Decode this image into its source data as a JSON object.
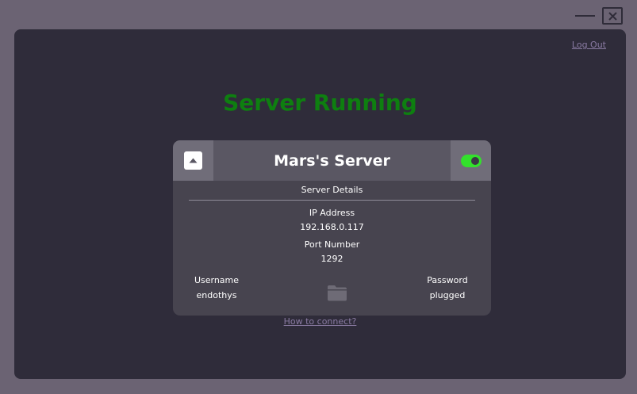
{
  "window": {
    "minimize_icon": "minimize-icon",
    "close_icon": "close-icon"
  },
  "header": {
    "logout_label": "Log Out"
  },
  "status": {
    "title": "Server Running",
    "color": "#0e7f10"
  },
  "server_card": {
    "name": "Mars's Server",
    "collapse_icon": "chevron-up-icon",
    "toggle_on": true,
    "toggle_color": "#33e12c",
    "details_heading": "Server Details",
    "ip_label": "IP Address",
    "ip_value": "192.168.0.117",
    "port_label": "Port Number",
    "port_value": "1292",
    "username_label": "Username",
    "username_value": "endothys",
    "password_label": "Password",
    "password_value": "plugged",
    "folder_icon": "folder-icon"
  },
  "footer": {
    "howto_label": "How to connect?"
  }
}
